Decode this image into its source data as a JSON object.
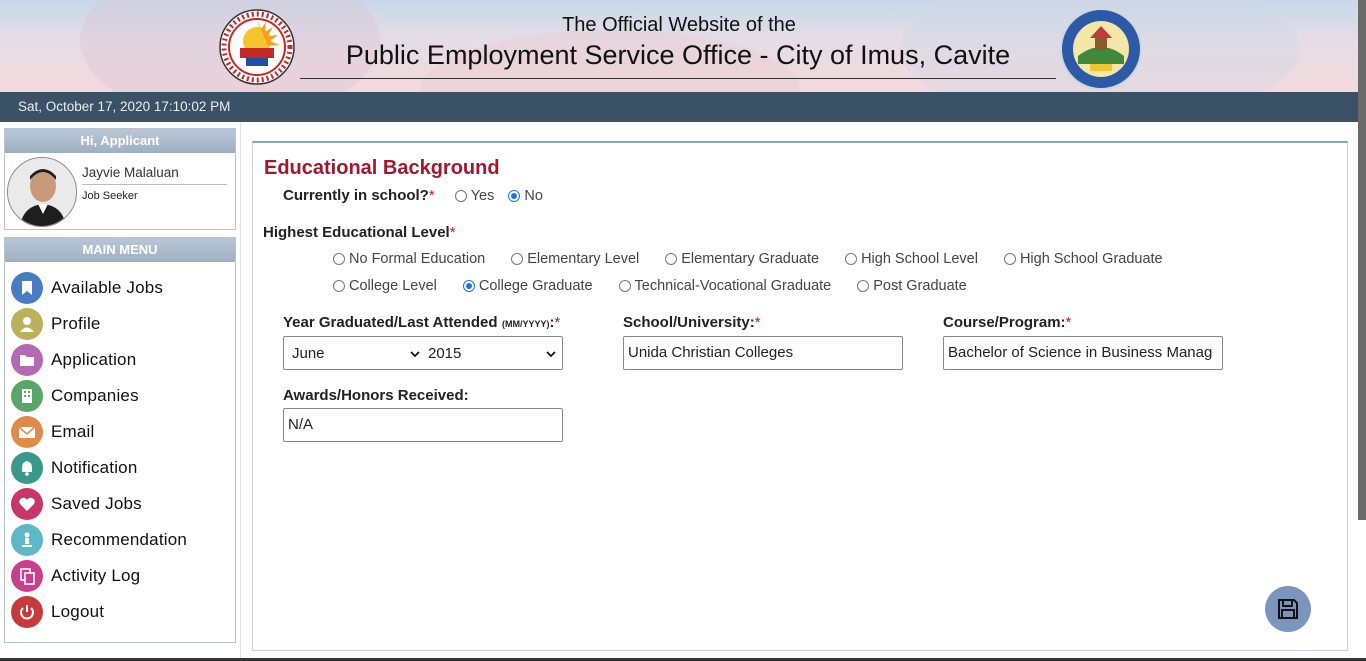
{
  "header": {
    "title_line1": "The Official Website of the",
    "title_line2": "Public Employment Service Office - City of Imus, Cavite",
    "datetime": "Sat, October 17, 2020 17:10:02 PM"
  },
  "user": {
    "greeting": "Hi, Applicant",
    "name": "Jayvie Malaluan",
    "role": "Job Seeker"
  },
  "menu": {
    "heading": "MAIN MENU",
    "items": [
      {
        "label": "Available Jobs",
        "icon": "bookmark-icon",
        "color": "#4a7cc4"
      },
      {
        "label": "Profile",
        "icon": "user-icon",
        "color": "#b9b25a"
      },
      {
        "label": "Application",
        "icon": "folder-icon",
        "color": "#b46ab2"
      },
      {
        "label": "Companies",
        "icon": "building-icon",
        "color": "#5aa66a"
      },
      {
        "label": "Email",
        "icon": "envelope-icon",
        "color": "#e08a4a"
      },
      {
        "label": "Notification",
        "icon": "bell-icon",
        "color": "#3a9a8a"
      },
      {
        "label": "Saved Jobs",
        "icon": "heart-icon",
        "color": "#c8356a"
      },
      {
        "label": "Recommendation",
        "icon": "person-pin-icon",
        "color": "#5fb8c8"
      },
      {
        "label": "Activity Log",
        "icon": "copy-icon",
        "color": "#c8408a"
      },
      {
        "label": "Logout",
        "icon": "power-icon",
        "color": "#c83a3a"
      }
    ]
  },
  "form": {
    "title": "Educational Background",
    "in_school_label": "Currently in school?",
    "required_mark": "*",
    "in_school_options": [
      {
        "label": "Yes",
        "checked": false
      },
      {
        "label": "No",
        "checked": true
      }
    ],
    "level_label": "Highest Educational Level",
    "levels_row1": [
      {
        "label": "No Formal Education",
        "checked": false
      },
      {
        "label": "Elementary Level",
        "checked": false
      },
      {
        "label": "Elementary Graduate",
        "checked": false
      },
      {
        "label": "High School Level",
        "checked": false
      },
      {
        "label": "High School Graduate",
        "checked": false
      }
    ],
    "levels_row2": [
      {
        "label": "College Level",
        "checked": false
      },
      {
        "label": "College Graduate",
        "checked": true
      },
      {
        "label": "Technical-Vocational Graduate",
        "checked": false
      },
      {
        "label": "Post Graduate",
        "checked": false
      }
    ],
    "year_label": "Year Graduated/Last Attended",
    "year_hint": "(MM/YYYY)",
    "month_value": "June",
    "year_value": "2015",
    "school_label": "School/University:",
    "school_value": "Unida Christian Colleges",
    "course_label": "Course/Program:",
    "course_value": "Bachelor of Science in Business Manag",
    "awards_label": "Awards/Honors Received:",
    "awards_value": "N/A",
    "accent_color": "#a3162f"
  }
}
